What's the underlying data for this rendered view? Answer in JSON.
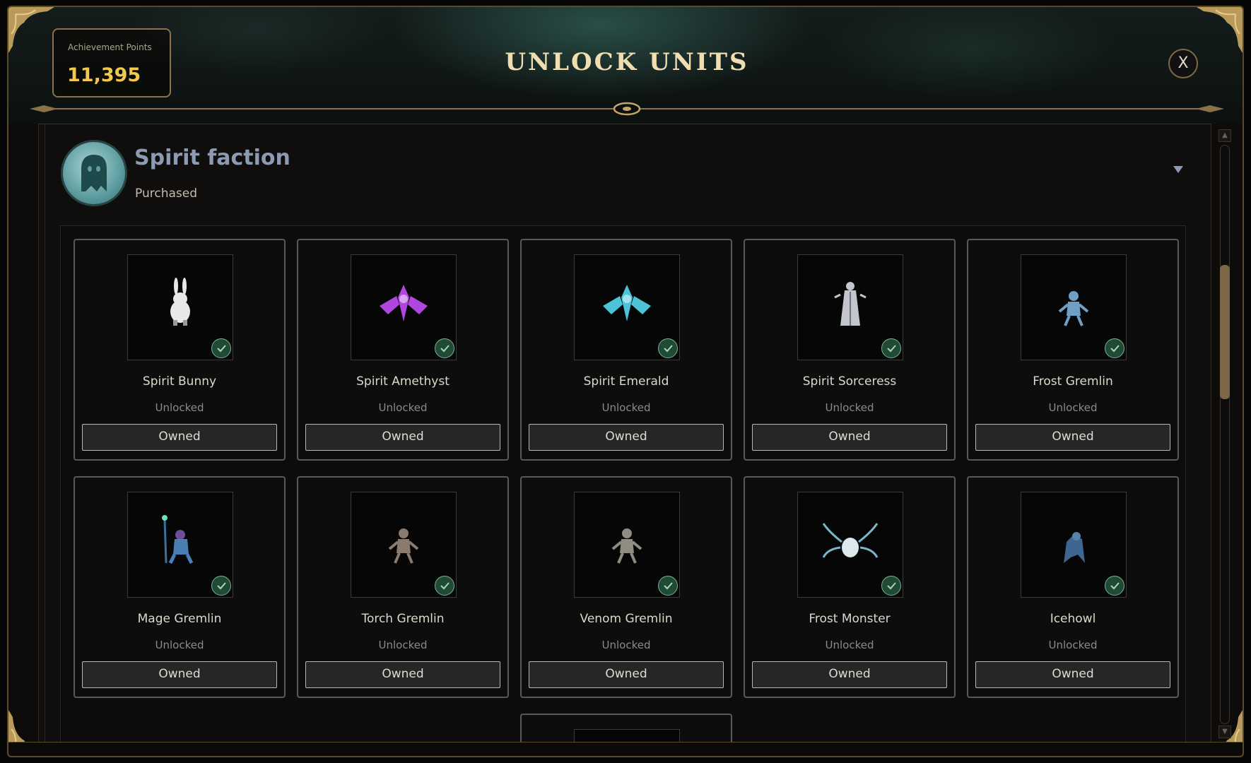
{
  "header": {
    "achievement_points_label": "Achievement Points",
    "achievement_points_value": "11,395",
    "title": "UNLOCK UNITS",
    "close_label": "X"
  },
  "faction": {
    "name": "Spirit faction",
    "status": "Purchased",
    "icon": "ghost-icon"
  },
  "units": [
    {
      "name": "Spirit Bunny",
      "status": "Unlocked",
      "action": "Owned",
      "icon": "bunny-figure",
      "color": "#e8e8e8"
    },
    {
      "name": "Spirit Amethyst",
      "status": "Unlocked",
      "action": "Owned",
      "icon": "crystal-figure",
      "color": "#b045e0"
    },
    {
      "name": "Spirit Emerald",
      "status": "Unlocked",
      "action": "Owned",
      "icon": "crystal-figure",
      "color": "#4cc4d8"
    },
    {
      "name": "Spirit Sorceress",
      "status": "Unlocked",
      "action": "Owned",
      "icon": "sorceress-figure",
      "color": "#c2c6cc"
    },
    {
      "name": "Frost Gremlin",
      "status": "Unlocked",
      "action": "Owned",
      "icon": "gremlin-figure",
      "color": "#6f9fc4"
    },
    {
      "name": "Mage Gremlin",
      "status": "Unlocked",
      "action": "Owned",
      "icon": "mage-figure",
      "color": "#4a7fb5"
    },
    {
      "name": "Torch Gremlin",
      "status": "Unlocked",
      "action": "Owned",
      "icon": "gremlin-figure",
      "color": "#8a7b6e"
    },
    {
      "name": "Venom Gremlin",
      "status": "Unlocked",
      "action": "Owned",
      "icon": "gremlin-figure",
      "color": "#8f8c80"
    },
    {
      "name": "Frost Monster",
      "status": "Unlocked",
      "action": "Owned",
      "icon": "monster-figure",
      "color": "#78b8c8"
    },
    {
      "name": "Icehowl",
      "status": "Unlocked",
      "action": "Owned",
      "icon": "beast-figure",
      "color": "#3f6690"
    }
  ],
  "colors": {
    "gold": "#f2c94c",
    "title": "#f0ddb0",
    "frame": "#5a4a2c",
    "check": "#1f4a35"
  }
}
